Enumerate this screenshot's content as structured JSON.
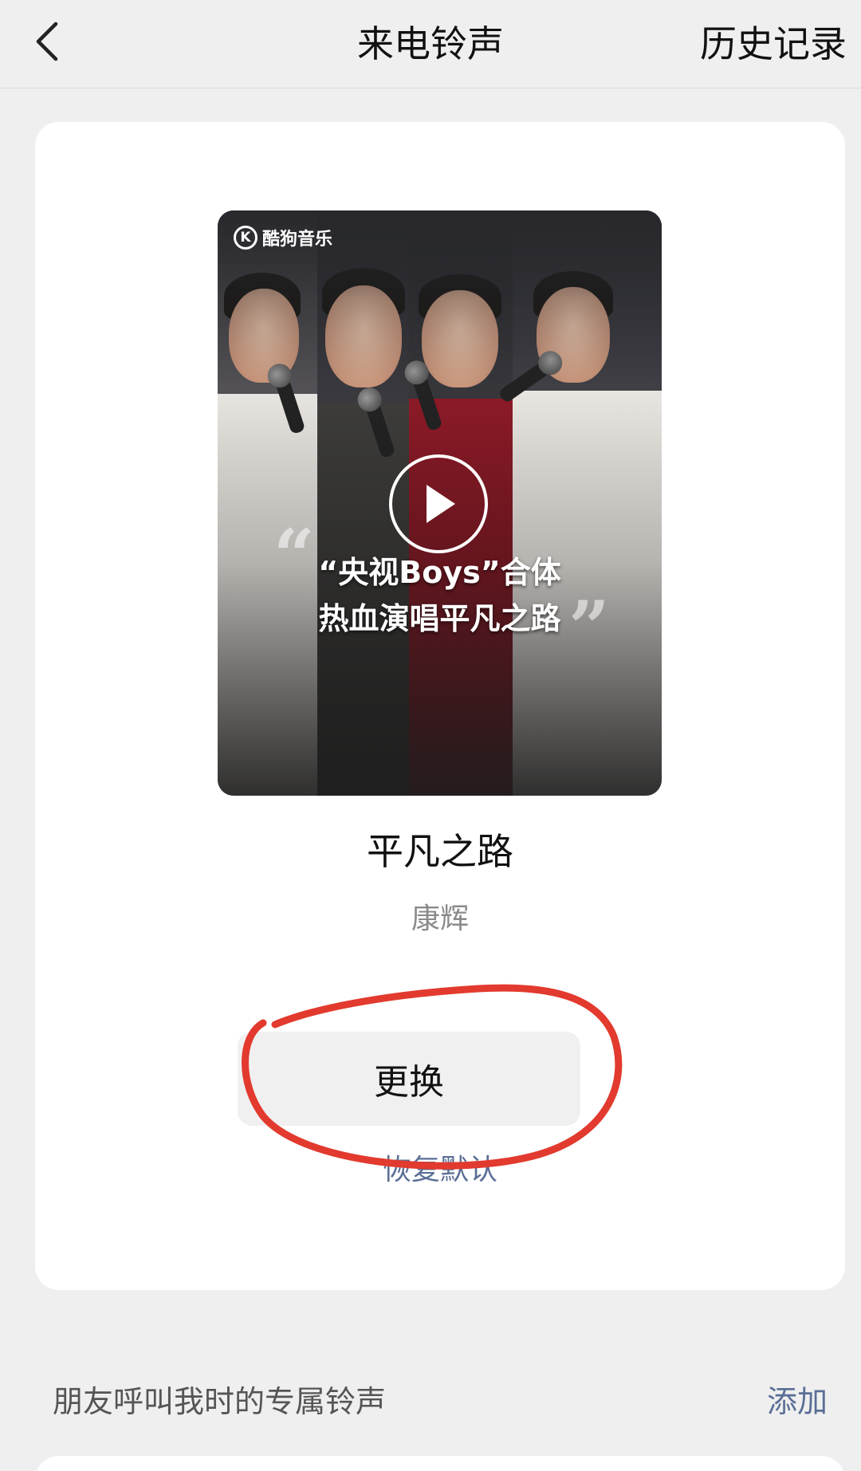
{
  "header": {
    "title": "来电铃声",
    "history_label": "历史记录"
  },
  "ringtone": {
    "cover": {
      "logo_text": "酷狗音乐",
      "logo_letter": "K",
      "caption_line1": "“央视Boys”合体",
      "caption_line2": "热血演唱平凡之路"
    },
    "song_title": "平凡之路",
    "artist": "康辉",
    "change_label": "更换",
    "restore_label": "恢复默认"
  },
  "friends_section": {
    "label": "朋友呼叫我时的专属铃声",
    "add_label": "添加"
  },
  "colors": {
    "link": "#5a6e95",
    "annotation": "#e23a2e"
  }
}
